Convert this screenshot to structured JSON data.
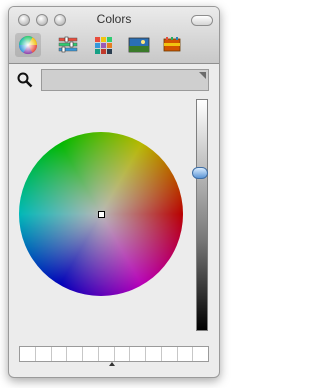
{
  "window": {
    "title": "Colors"
  },
  "toolbar": {
    "modes": [
      {
        "icon": "color-wheel-icon",
        "selected": true
      },
      {
        "icon": "color-sliders-icon",
        "selected": false
      },
      {
        "icon": "color-palettes-icon",
        "selected": false
      },
      {
        "icon": "image-palettes-icon",
        "selected": false
      },
      {
        "icon": "crayons-icon",
        "selected": false
      }
    ]
  },
  "search": {
    "placeholder": ""
  },
  "wheel": {
    "brightness_percent": 72
  },
  "swatches": {
    "count": 12
  },
  "colors": {
    "selection_blue": "#5b95d6",
    "window_bg": "#ececec"
  }
}
